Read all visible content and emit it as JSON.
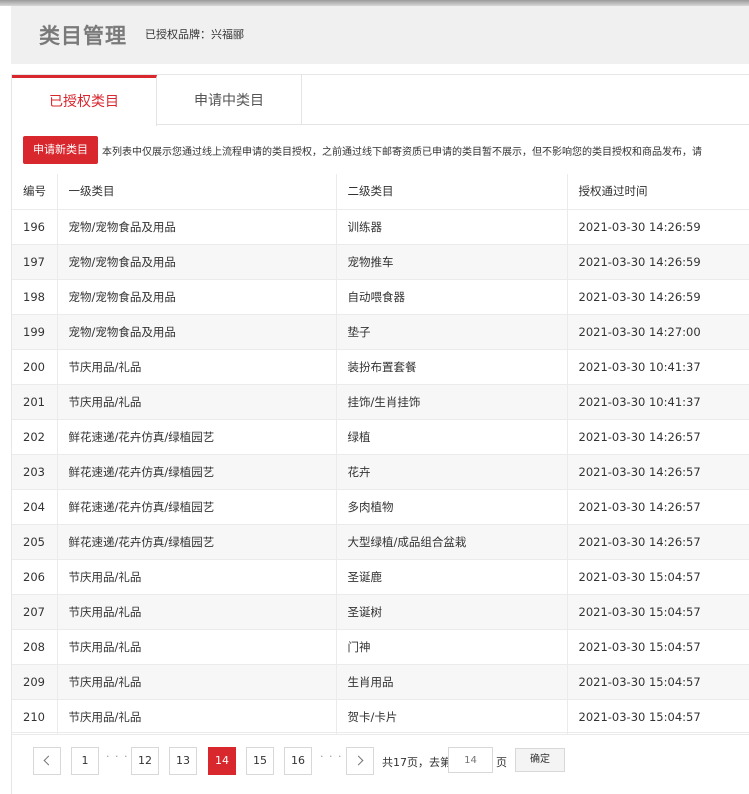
{
  "header": {
    "title": "类目管理",
    "brand": "已授权品牌：兴福郦"
  },
  "tabs": [
    {
      "label": "已授权类目",
      "active": true
    },
    {
      "label": "申请中类目",
      "active": false
    }
  ],
  "notice": {
    "button": "申请新类目",
    "text": "本列表中仅展示您通过线上流程申请的类目授权，之前通过线下邮寄资质已申请的类目暂不展示，但不影响您的类目授权和商品发布，请"
  },
  "table": {
    "columns": [
      "编号",
      "一级类目",
      "二级类目",
      "授权通过时间"
    ],
    "rows": [
      [
        "196",
        "宠物/宠物食品及用品",
        "训练器",
        "2021-03-30 14:26:59"
      ],
      [
        "197",
        "宠物/宠物食品及用品",
        "宠物推车",
        "2021-03-30 14:26:59"
      ],
      [
        "198",
        "宠物/宠物食品及用品",
        "自动喂食器",
        "2021-03-30 14:26:59"
      ],
      [
        "199",
        "宠物/宠物食品及用品",
        "垫子",
        "2021-03-30 14:27:00"
      ],
      [
        "200",
        "节庆用品/礼品",
        "装扮布置套餐",
        "2021-03-30 10:41:37"
      ],
      [
        "201",
        "节庆用品/礼品",
        "挂饰/生肖挂饰",
        "2021-03-30 10:41:37"
      ],
      [
        "202",
        "鲜花速递/花卉仿真/绿植园艺",
        "绿植",
        "2021-03-30 14:26:57"
      ],
      [
        "203",
        "鲜花速递/花卉仿真/绿植园艺",
        "花卉",
        "2021-03-30 14:26:57"
      ],
      [
        "204",
        "鲜花速递/花卉仿真/绿植园艺",
        "多肉植物",
        "2021-03-30 14:26:57"
      ],
      [
        "205",
        "鲜花速递/花卉仿真/绿植园艺",
        "大型绿植/成品组合盆栽",
        "2021-03-30 14:26:57"
      ],
      [
        "206",
        "节庆用品/礼品",
        "圣诞鹿",
        "2021-03-30 15:04:57"
      ],
      [
        "207",
        "节庆用品/礼品",
        "圣诞树",
        "2021-03-30 15:04:57"
      ],
      [
        "208",
        "节庆用品/礼品",
        "门神",
        "2021-03-30 15:04:57"
      ],
      [
        "209",
        "节庆用品/礼品",
        "生肖用品",
        "2021-03-30 15:04:57"
      ],
      [
        "210",
        "节庆用品/礼品",
        "贺卡/卡片",
        "2021-03-30 15:04:57"
      ]
    ]
  },
  "pagination": {
    "pages": [
      "1",
      "12",
      "13",
      "14",
      "15",
      "16"
    ],
    "current": "14",
    "ellipsis": "· · ·",
    "total_text": "共17页，去第",
    "page_unit": "页",
    "input_placeholder": "14",
    "confirm_label": "确定",
    "prev_icon": "chevron-left-icon",
    "next_icon": "chevron-right-icon"
  },
  "colors": {
    "accent": "#d9272e",
    "header_bg": "#f0f0f0",
    "row_alt": "#f7f7f7"
  }
}
